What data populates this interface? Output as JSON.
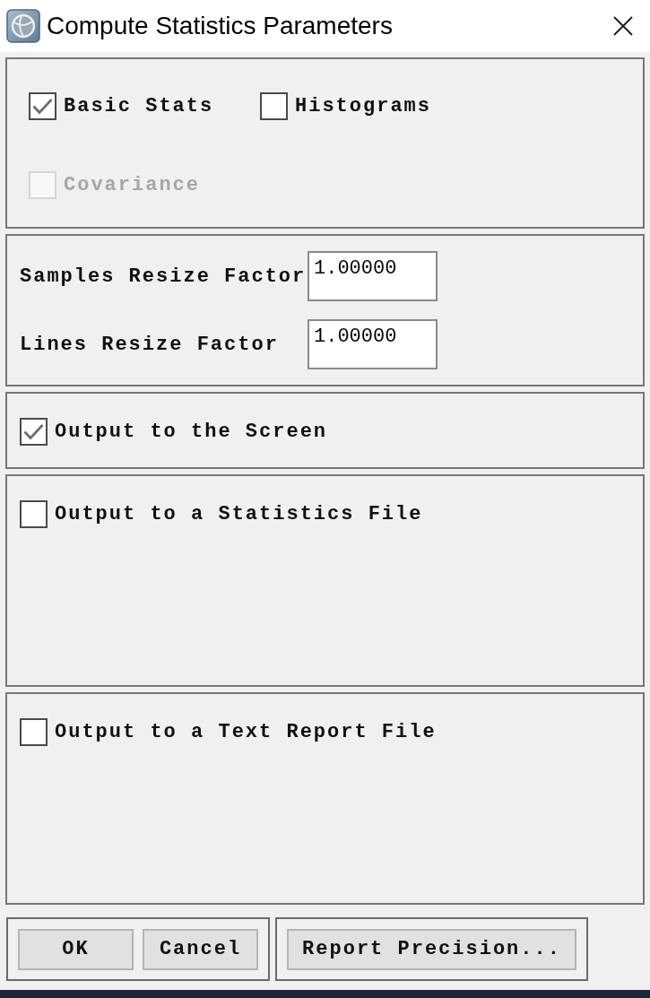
{
  "window": {
    "title": "Compute Statistics Parameters"
  },
  "stats_options": [
    {
      "label": "Basic Stats",
      "checked": true,
      "disabled": false
    },
    {
      "label": "Histograms",
      "checked": false,
      "disabled": false
    },
    {
      "label": "Covariance",
      "checked": false,
      "disabled": true
    }
  ],
  "resize_factors": [
    {
      "label": "Samples Resize Factor",
      "value": "1.00000"
    },
    {
      "label": "Lines Resize Factor",
      "value": "1.00000"
    }
  ],
  "outputs": [
    {
      "kind": "screen",
      "label": "Output to the Screen",
      "checked": true
    },
    {
      "kind": "file",
      "label": "Output to a Statistics File",
      "checked": false
    },
    {
      "kind": "file",
      "label": "Output to a Text Report File",
      "checked": false
    }
  ],
  "dialog_buttons": [
    "OK",
    "Cancel"
  ],
  "extra_buttons": [
    "Report Precision..."
  ]
}
